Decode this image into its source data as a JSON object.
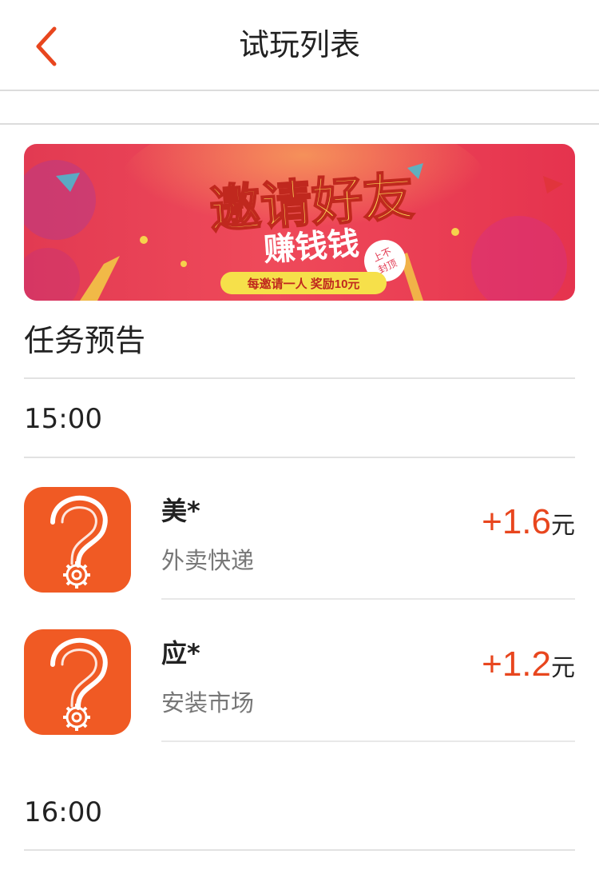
{
  "header": {
    "title": "试玩列表",
    "back_icon": "chevron-left-icon",
    "accent": "#e8461e"
  },
  "banner": {
    "headline": "邀请好友",
    "subline": "赚钱钱",
    "badge": "上不封顶",
    "ribbon": "每邀请一人 奖励10元"
  },
  "section": {
    "title": "任务预告"
  },
  "groups": [
    {
      "time": "15:00",
      "tasks": [
        {
          "name": "美*",
          "category": "外卖快递",
          "reward": "+1.6",
          "unit": "元",
          "icon": "question-gear-icon"
        },
        {
          "name": "应*",
          "category": "安装市场",
          "reward": "+1.2",
          "unit": "元",
          "icon": "question-gear-icon"
        }
      ]
    },
    {
      "time": "16:00",
      "tasks": []
    }
  ],
  "colors": {
    "icon_bg": "#f05a24",
    "reward": "#e8461e",
    "banner_bg": "#e8344a"
  }
}
